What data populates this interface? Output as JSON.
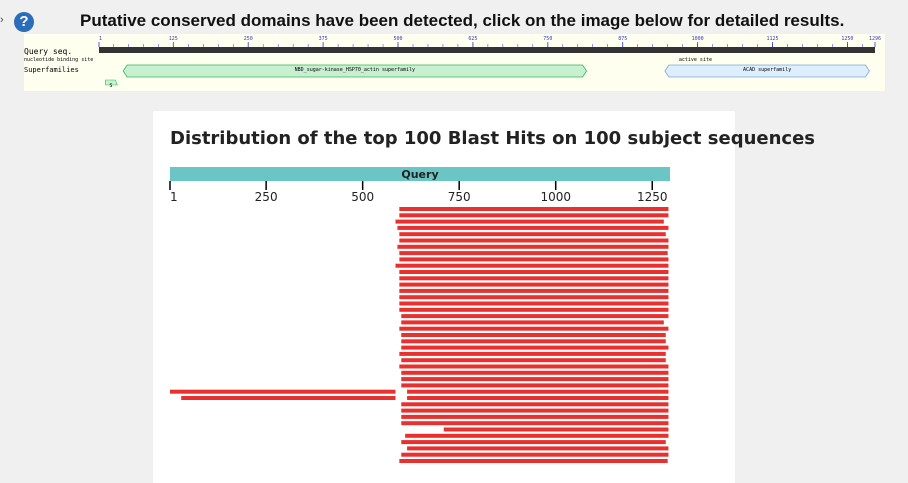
{
  "header": {
    "chevron": "›",
    "help_icon_glyph": "?",
    "title": "Putative conserved domains have been detected, click on the image below for detailed results."
  },
  "cdd": {
    "query_label": "Query seq.",
    "binding_label": "nucleotide binding site",
    "active_label": "active site",
    "superfamilies_label": "Superfamilies",
    "ticks": [
      1,
      125,
      250,
      375,
      500,
      625,
      750,
      875,
      1000,
      1125,
      1250,
      1296
    ],
    "query_length": 1296,
    "domains": [
      {
        "name": "NBD_sugar-kinase_HSP70_actin superfamily",
        "start": 48,
        "end": 808,
        "color": "#c8f0d0",
        "stroke": "#2eb85c"
      },
      {
        "name": "ACAD superfamily",
        "start": 952,
        "end": 1280,
        "color": "#ddeeff",
        "stroke": "#7aa7d8"
      }
    ],
    "small_mark": {
      "label": "S",
      "position": 20
    }
  },
  "blast": {
    "title": "Distribution of the top 100 Blast Hits on 100 subject sequences",
    "query_label": "Query",
    "axis_ticks": [
      1,
      250,
      500,
      750,
      1000,
      1250
    ],
    "query_length": 1296,
    "hit_color": "#e8302f",
    "query_bar_color": "#6cc5c5",
    "hits": [
      [
        [
          595,
          1292
        ]
      ],
      [
        [
          595,
          1292
        ]
      ],
      [
        [
          585,
          1280
        ]
      ],
      [
        [
          590,
          1292
        ]
      ],
      [
        [
          595,
          1285
        ]
      ],
      [
        [
          595,
          1292
        ]
      ],
      [
        [
          590,
          1292
        ]
      ],
      [
        [
          595,
          1290
        ]
      ],
      [
        [
          595,
          1292
        ]
      ],
      [
        [
          585,
          1292
        ]
      ],
      [
        [
          595,
          1292
        ]
      ],
      [
        [
          595,
          1292
        ]
      ],
      [
        [
          595,
          1292
        ]
      ],
      [
        [
          595,
          1292
        ]
      ],
      [
        [
          595,
          1292
        ]
      ],
      [
        [
          595,
          1292
        ]
      ],
      [
        [
          595,
          1292
        ]
      ],
      [
        [
          600,
          1292
        ]
      ],
      [
        [
          600,
          1280
        ]
      ],
      [
        [
          595,
          1292
        ]
      ],
      [
        [
          600,
          1285
        ]
      ],
      [
        [
          600,
          1285
        ]
      ],
      [
        [
          600,
          1292
        ]
      ],
      [
        [
          595,
          1285
        ]
      ],
      [
        [
          600,
          1285
        ]
      ],
      [
        [
          595,
          1292
        ]
      ],
      [
        [
          600,
          1292
        ]
      ],
      [
        [
          600,
          1292
        ]
      ],
      [
        [
          600,
          1292
        ]
      ],
      [
        [
          1,
          585
        ],
        [
          615,
          1292
        ]
      ],
      [
        [
          30,
          585
        ],
        [
          615,
          1292
        ]
      ],
      [
        [
          600,
          1292
        ]
      ],
      [
        [
          600,
          1292
        ]
      ],
      [
        [
          600,
          1292
        ]
      ],
      [
        [
          600,
          1292
        ]
      ],
      [
        [
          710,
          1292
        ]
      ],
      [
        [
          610,
          1292
        ]
      ],
      [
        [
          600,
          1285
        ]
      ],
      [
        [
          615,
          1292
        ]
      ],
      [
        [
          600,
          1292
        ]
      ],
      [
        [
          595,
          1290
        ]
      ]
    ]
  }
}
